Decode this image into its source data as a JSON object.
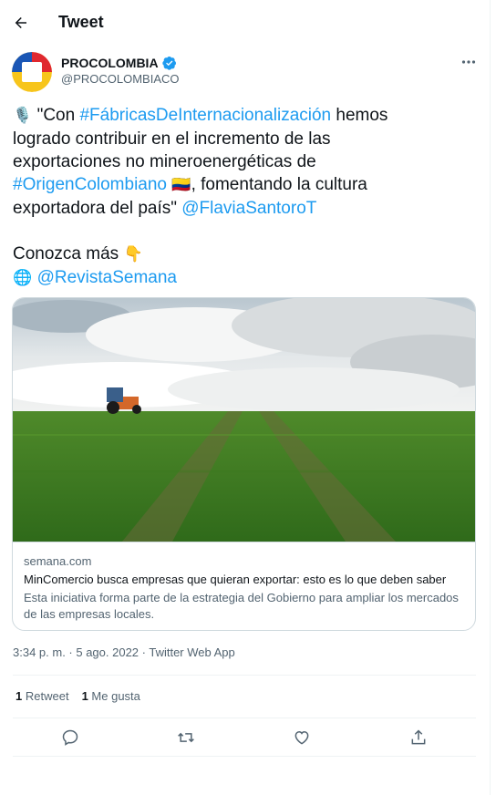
{
  "header": {
    "title": "Tweet"
  },
  "author": {
    "name": "PROCOLOMBIA",
    "handle": "@PROCOLOMBIACO"
  },
  "tweet": {
    "lines": [
      [
        {
          "t": "🎙️ ",
          "k": "emoji"
        },
        {
          "t": "\"Con ",
          "k": "text"
        },
        {
          "t": "#FábricasDeInternacionalización",
          "k": "link"
        },
        {
          "t": " hemos",
          "k": "text"
        }
      ],
      [
        {
          "t": "logrado contribuir en el incremento de las",
          "k": "text"
        }
      ],
      [
        {
          "t": "exportaciones no mineroenergéticas de",
          "k": "text"
        }
      ],
      [
        {
          "t": "#OrigenColombiano",
          "k": "link"
        },
        {
          "t": " 🇨🇴",
          "k": "emoji"
        },
        {
          "t": ", fomentando la cultura",
          "k": "text"
        }
      ],
      [
        {
          "t": "exportadora del país\" ",
          "k": "text"
        },
        {
          "t": "@FlaviaSantoroT",
          "k": "link"
        }
      ],
      [
        {
          "t": " ",
          "k": "text"
        }
      ],
      [
        {
          "t": "Conozca más ",
          "k": "text"
        },
        {
          "t": "👇",
          "k": "emoji"
        }
      ],
      [
        {
          "t": "🌐 ",
          "k": "emoji"
        },
        {
          "t": "@RevistaSemana",
          "k": "link"
        }
      ]
    ]
  },
  "card": {
    "domain": "semana.com",
    "title": "MinComercio busca empresas que quieran exportar: esto es lo que deben saber",
    "description": "Esta iniciativa forma parte de la estrategia del Gobierno para ampliar los mercados de las empresas locales."
  },
  "meta": {
    "timestamp": "3:34 p. m. · 5 ago. 2022 · Twitter Web App"
  },
  "stats": {
    "retweets_count": "1",
    "retweets_label": "Retweet",
    "likes_count": "1",
    "likes_label": "Me gusta"
  },
  "colors": {
    "link": "#1d9bf0",
    "muted": "#536471",
    "border": "#cfd9de"
  },
  "icons": [
    "back-arrow-icon",
    "verified-badge-icon",
    "more-options-icon",
    "reply-icon",
    "retweet-icon",
    "like-icon",
    "share-icon"
  ]
}
